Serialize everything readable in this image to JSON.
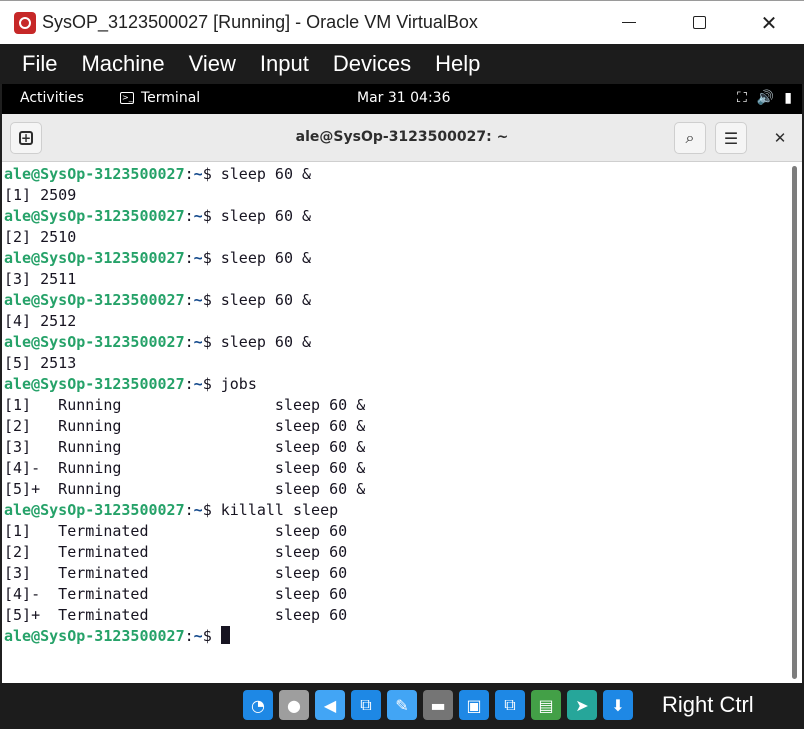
{
  "window": {
    "title": "SysOP_3123500027 [Running] - Oracle VM VirtualBox",
    "minimize": "minimize",
    "maximize": "maximize",
    "close_glyph": "✕"
  },
  "vbox_menu": [
    "File",
    "Machine",
    "View",
    "Input",
    "Devices",
    "Help"
  ],
  "gnome": {
    "activities": "Activities",
    "app_name": "Terminal",
    "clock": "Mar 31  04:36",
    "tray": {
      "network": "⛶",
      "volume": "🔊",
      "battery": "▮"
    }
  },
  "terminal": {
    "title": "ale@SysOp-3123500027: ~",
    "newtab_glyph": "+",
    "search_glyph": "⌕",
    "menu_glyph": "☰",
    "close_glyph": "✕",
    "prompt_user": "ale@SysOp-3123500027",
    "prompt_path": "~",
    "lines": [
      {
        "type": "cmd",
        "text": "sleep 60 &"
      },
      {
        "type": "out",
        "text": "[1] 2509"
      },
      {
        "type": "cmd",
        "text": "sleep 60 &"
      },
      {
        "type": "out",
        "text": "[2] 2510"
      },
      {
        "type": "cmd",
        "text": "sleep 60 &"
      },
      {
        "type": "out",
        "text": "[3] 2511"
      },
      {
        "type": "cmd",
        "text": "sleep 60 &"
      },
      {
        "type": "out",
        "text": "[4] 2512"
      },
      {
        "type": "cmd",
        "text": "sleep 60 &"
      },
      {
        "type": "out",
        "text": "[5] 2513"
      },
      {
        "type": "cmd",
        "text": "jobs"
      },
      {
        "type": "out",
        "text": "[1]   Running                 sleep 60 &"
      },
      {
        "type": "out",
        "text": "[2]   Running                 sleep 60 &"
      },
      {
        "type": "out",
        "text": "[3]   Running                 sleep 60 &"
      },
      {
        "type": "out",
        "text": "[4]-  Running                 sleep 60 &"
      },
      {
        "type": "out",
        "text": "[5]+  Running                 sleep 60 &"
      },
      {
        "type": "cmd",
        "text": "killall sleep"
      },
      {
        "type": "out",
        "text": "[1]   Terminated              sleep 60"
      },
      {
        "type": "out",
        "text": "[2]   Terminated              sleep 60"
      },
      {
        "type": "out",
        "text": "[3]   Terminated              sleep 60"
      },
      {
        "type": "out",
        "text": "[4]-  Terminated              sleep 60"
      },
      {
        "type": "out",
        "text": "[5]+  Terminated              sleep 60"
      },
      {
        "type": "cursor",
        "text": ""
      }
    ]
  },
  "status_bar": {
    "icons": [
      {
        "name": "hard-disk-icon",
        "glyph": "◔",
        "color": "#1e88e5"
      },
      {
        "name": "optical-drive-icon",
        "glyph": "●",
        "color": "#9e9e9e"
      },
      {
        "name": "audio-icon",
        "glyph": "◀",
        "color": "#42a5f5"
      },
      {
        "name": "network-icon",
        "glyph": "⧉",
        "color": "#1e88e5"
      },
      {
        "name": "usb-icon",
        "glyph": "✎",
        "color": "#42a5f5"
      },
      {
        "name": "shared-folders-icon",
        "glyph": "▬",
        "color": "#757575"
      },
      {
        "name": "display-icon",
        "glyph": "▣",
        "color": "#1e88e5"
      },
      {
        "name": "video-capture-icon",
        "glyph": "⧉",
        "color": "#1e88e5"
      },
      {
        "name": "cpu-icon",
        "glyph": "▤",
        "color": "#43a047"
      },
      {
        "name": "mouse-integration-icon",
        "glyph": "➤",
        "color": "#26a69a"
      },
      {
        "name": "keyboard-icon",
        "glyph": "⬇",
        "color": "#1e88e5"
      }
    ],
    "host_key": "Right Ctrl"
  }
}
